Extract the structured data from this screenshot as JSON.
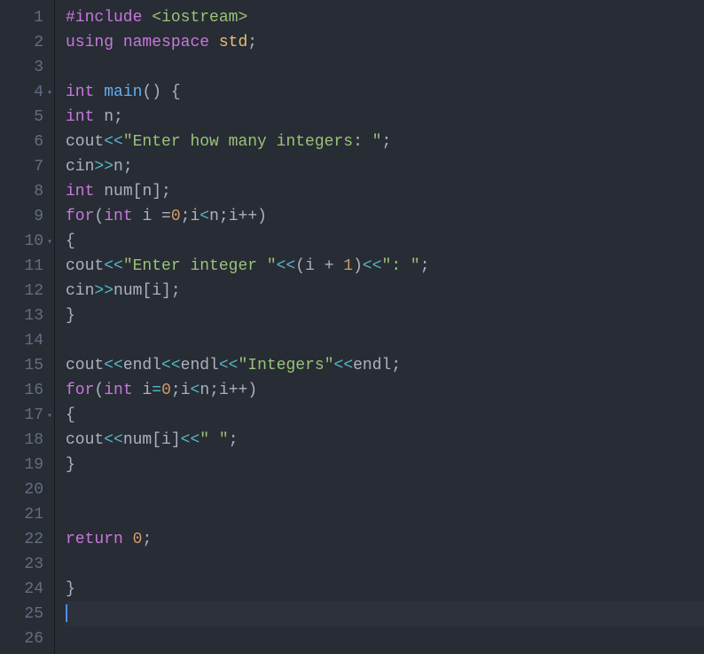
{
  "gutter": {
    "lines": [
      "1",
      "2",
      "3",
      "4",
      "5",
      "6",
      "7",
      "8",
      "9",
      "10",
      "11",
      "12",
      "13",
      "14",
      "15",
      "16",
      "17",
      "18",
      "19",
      "20",
      "21",
      "22",
      "23",
      "24",
      "25",
      "26"
    ],
    "foldable": [
      4,
      10,
      17
    ],
    "activeLine": 25
  },
  "code": {
    "l1": {
      "t1": "#include",
      "t2": " ",
      "t3": "<iostream>"
    },
    "l2": {
      "t1": "using",
      "t2": " ",
      "t3": "namespace",
      "t4": " ",
      "t5": "std",
      "t6": ";"
    },
    "l3": {
      "t1": ""
    },
    "l4": {
      "t1": "int",
      "t2": " ",
      "t3": "main",
      "t4": "() {"
    },
    "l5": {
      "t1": "int",
      "t2": " ",
      "t3": "n",
      "t4": ";"
    },
    "l6": {
      "t1": "cout",
      "t2": "<<",
      "t3": "\"Enter how many integers: \"",
      "t4": ";"
    },
    "l7": {
      "t1": "cin",
      "t2": ">>",
      "t3": "n",
      "t4": ";"
    },
    "l8": {
      "t1": "int",
      "t2": " ",
      "t3": "num",
      "t4": "[",
      "t5": "n",
      "t6": "];"
    },
    "l9": {
      "t1": "for",
      "t2": "(",
      "t3": "int",
      "t4": " ",
      "t5": "i",
      "t6": " =",
      "t7": "0",
      "t8": ";",
      "t9": "i",
      "t10": "<",
      "t11": "n",
      "t12": ";",
      "t13": "i",
      "t14": "++)"
    },
    "l10": {
      "t1": "{"
    },
    "l11": {
      "t1": "cout",
      "t2": "<<",
      "t3": "\"Enter integer \"",
      "t4": "<<",
      "t5": "(",
      "t6": "i",
      "t7": " + ",
      "t8": "1",
      "t9": ")",
      "t10": "<<",
      "t11": "\": \"",
      "t12": ";"
    },
    "l12": {
      "t1": "cin",
      "t2": ">>",
      "t3": "num",
      "t4": "[",
      "t5": "i",
      "t6": "];"
    },
    "l13": {
      "t1": "}"
    },
    "l14": {
      "t1": ""
    },
    "l15": {
      "t1": "cout",
      "t2": "<<",
      "t3": "endl",
      "t4": "<<",
      "t5": "endl",
      "t6": "<<",
      "t7": "\"Integers\"",
      "t8": "<<",
      "t9": "endl",
      "t10": ";"
    },
    "l16": {
      "t1": "for",
      "t2": "(",
      "t3": "int",
      "t4": " ",
      "t5": "i",
      "t6": "=",
      "t7": "0",
      "t8": ";",
      "t9": "i",
      "t10": "<",
      "t11": "n",
      "t12": ";",
      "t13": "i",
      "t14": "++)"
    },
    "l17": {
      "t1": "{"
    },
    "l18": {
      "t1": "cout",
      "t2": "<<",
      "t3": "num",
      "t4": "[",
      "t5": "i",
      "t6": "]",
      "t7": "<<",
      "t8": "\" \"",
      "t9": ";"
    },
    "l19": {
      "t1": "}"
    },
    "l20": {
      "t1": ""
    },
    "l21": {
      "t1": ""
    },
    "l22": {
      "t1": "return",
      "t2": " ",
      "t3": "0",
      "t4": ";"
    },
    "l23": {
      "t1": ""
    },
    "l24": {
      "t1": "}"
    },
    "l25": {
      "t1": ""
    },
    "l26": {
      "t1": ""
    }
  }
}
